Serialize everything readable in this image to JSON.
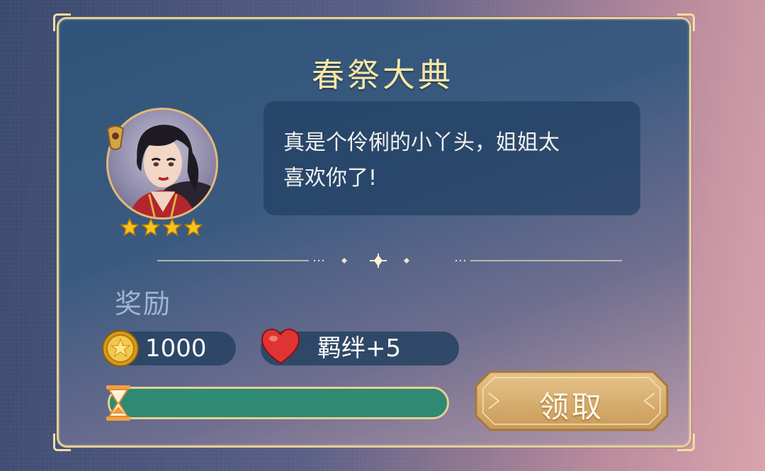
{
  "event": {
    "title": "春祭大典"
  },
  "character": {
    "stars": 4,
    "dialogue_line1": "真是个伶俐的小丫头，姐姐太",
    "dialogue_line2": "喜欢你了!"
  },
  "rewards": {
    "label": "奖励",
    "coins": "1000",
    "bond": "羁绊+5"
  },
  "progress": {
    "fraction": 1.0
  },
  "claim_button": {
    "label": "领取"
  },
  "colors": {
    "title": "#f6e6a6",
    "progress_fill": "#2e8a72",
    "button_gold": "#d9b070",
    "panel_border": "#e6cf9c"
  },
  "icons": [
    "coin-icon",
    "heart-icon",
    "star-icon",
    "hourglass-icon",
    "sparkle-divider-icon"
  ]
}
